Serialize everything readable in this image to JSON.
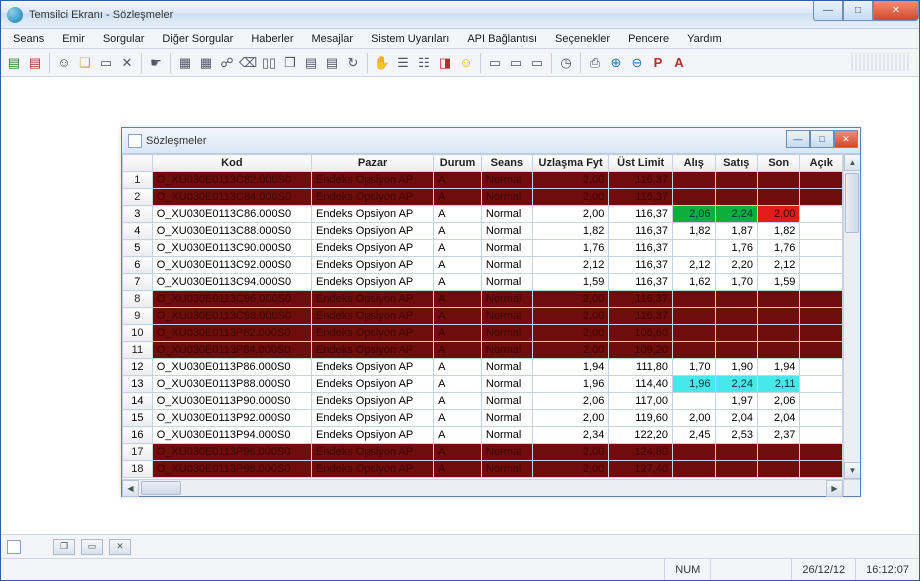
{
  "window": {
    "title": "Temsilci Ekranı - Sözleşmeler"
  },
  "menu": [
    "Seans",
    "Emir",
    "Sorgular",
    "Diğer Sorgular",
    "Haberler",
    "Mesajlar",
    "Sistem Uyarıları",
    "API Bağlantısı",
    "Seçenekler",
    "Pencere",
    "Yardım"
  ],
  "inner": {
    "title": "Sözleşmeler"
  },
  "columns": [
    "",
    "Kod",
    "Pazar",
    "Durum",
    "Seans",
    "Uzlaşma Fyt",
    "Üst Limit",
    "Alış",
    "Satış",
    "Son",
    "Açık"
  ],
  "rows": [
    {
      "n": "1",
      "kod": "O_XU030E0113C82.000S0",
      "pazar": "Endeks Opsiyon AP",
      "durum": "A",
      "seans": "Normal",
      "uzl": "2,00",
      "ust": "116,37",
      "alis": "",
      "satis": "",
      "son": "",
      "style": "dark"
    },
    {
      "n": "2",
      "kod": "O_XU030E0113C84.000S0",
      "pazar": "Endeks Opsiyon AP",
      "durum": "A",
      "seans": "Normal",
      "uzl": "2,00",
      "ust": "116,37",
      "alis": "",
      "satis": "",
      "son": "",
      "style": "dark"
    },
    {
      "n": "3",
      "kod": "O_XU030E0113C86.000S0",
      "pazar": "Endeks Opsiyon AP",
      "durum": "A",
      "seans": "Normal",
      "uzl": "2,00",
      "ust": "116,37",
      "alis": "2,06",
      "satis": "2,24",
      "son": "2,00",
      "style": "hl1"
    },
    {
      "n": "4",
      "kod": "O_XU030E0113C88.000S0",
      "pazar": "Endeks Opsiyon AP",
      "durum": "A",
      "seans": "Normal",
      "uzl": "1,82",
      "ust": "116,37",
      "alis": "1,82",
      "satis": "1,87",
      "son": "1,82",
      "style": ""
    },
    {
      "n": "5",
      "kod": "O_XU030E0113C90.000S0",
      "pazar": "Endeks Opsiyon AP",
      "durum": "A",
      "seans": "Normal",
      "uzl": "1,76",
      "ust": "116,37",
      "alis": "",
      "satis": "1,76",
      "son": "1,76",
      "style": ""
    },
    {
      "n": "6",
      "kod": "O_XU030E0113C92.000S0",
      "pazar": "Endeks Opsiyon AP",
      "durum": "A",
      "seans": "Normal",
      "uzl": "2,12",
      "ust": "116,37",
      "alis": "2,12",
      "satis": "2,20",
      "son": "2,12",
      "style": ""
    },
    {
      "n": "7",
      "kod": "O_XU030E0113C94.000S0",
      "pazar": "Endeks Opsiyon AP",
      "durum": "A",
      "seans": "Normal",
      "uzl": "1,59",
      "ust": "116,37",
      "alis": "1,62",
      "satis": "1,70",
      "son": "1,59",
      "style": ""
    },
    {
      "n": "8",
      "kod": "O_XU030E0113C96.000S0",
      "pazar": "Endeks Opsiyon AP",
      "durum": "A",
      "seans": "Normal",
      "uzl": "2,00",
      "ust": "116,37",
      "alis": "",
      "satis": "",
      "son": "",
      "style": "dark"
    },
    {
      "n": "9",
      "kod": "O_XU030E0113C98.000S0",
      "pazar": "Endeks Opsiyon AP",
      "durum": "A",
      "seans": "Normal",
      "uzl": "2,00",
      "ust": "116,37",
      "alis": "",
      "satis": "",
      "son": "",
      "style": "dark"
    },
    {
      "n": "10",
      "kod": "O_XU030E0113P82.000S0",
      "pazar": "Endeks Opsiyon AP",
      "durum": "A",
      "seans": "Normal",
      "uzl": "2,00",
      "ust": "106,60",
      "alis": "",
      "satis": "",
      "son": "",
      "style": "dark"
    },
    {
      "n": "11",
      "kod": "O_XU030E0113P84.000S0",
      "pazar": "Endeks Opsiyon AP",
      "durum": "A",
      "seans": "Normal",
      "uzl": "2,00",
      "ust": "109,20",
      "alis": "",
      "satis": "",
      "son": "",
      "style": "dark"
    },
    {
      "n": "12",
      "kod": "O_XU030E0113P86.000S0",
      "pazar": "Endeks Opsiyon AP",
      "durum": "A",
      "seans": "Normal",
      "uzl": "1,94",
      "ust": "111,80",
      "alis": "1,70",
      "satis": "1,90",
      "son": "1,94",
      "style": ""
    },
    {
      "n": "13",
      "kod": "O_XU030E0113P88.000S0",
      "pazar": "Endeks Opsiyon AP",
      "durum": "A",
      "seans": "Normal",
      "uzl": "1,96",
      "ust": "114,40",
      "alis": "1,96",
      "satis": "2,24",
      "son": "2,11",
      "style": "hl2"
    },
    {
      "n": "14",
      "kod": "O_XU030E0113P90.000S0",
      "pazar": "Endeks Opsiyon AP",
      "durum": "A",
      "seans": "Normal",
      "uzl": "2,06",
      "ust": "117,00",
      "alis": "",
      "satis": "1,97",
      "son": "2,06",
      "style": ""
    },
    {
      "n": "15",
      "kod": "O_XU030E0113P92.000S0",
      "pazar": "Endeks Opsiyon AP",
      "durum": "A",
      "seans": "Normal",
      "uzl": "2,00",
      "ust": "119,60",
      "alis": "2,00",
      "satis": "2,04",
      "son": "2,04",
      "style": ""
    },
    {
      "n": "16",
      "kod": "O_XU030E0113P94.000S0",
      "pazar": "Endeks Opsiyon AP",
      "durum": "A",
      "seans": "Normal",
      "uzl": "2,34",
      "ust": "122,20",
      "alis": "2,45",
      "satis": "2,53",
      "son": "2,37",
      "style": ""
    },
    {
      "n": "17",
      "kod": "O_XU030E0113P96.000S0",
      "pazar": "Endeks Opsiyon AP",
      "durum": "A",
      "seans": "Normal",
      "uzl": "2,00",
      "ust": "124,80",
      "alis": "",
      "satis": "",
      "son": "",
      "style": "dark"
    },
    {
      "n": "18",
      "kod": "O_XU030E0113P98.000S0",
      "pazar": "Endeks Opsiyon AP",
      "durum": "A",
      "seans": "Normal",
      "uzl": "2,00",
      "ust": "127,40",
      "alis": "",
      "satis": "",
      "son": "",
      "style": "dark"
    }
  ],
  "status": {
    "num": "NUM",
    "date": "26/12/12",
    "time": "16:12:07"
  },
  "toolbar_letters": {
    "p": "P",
    "a": "A"
  }
}
